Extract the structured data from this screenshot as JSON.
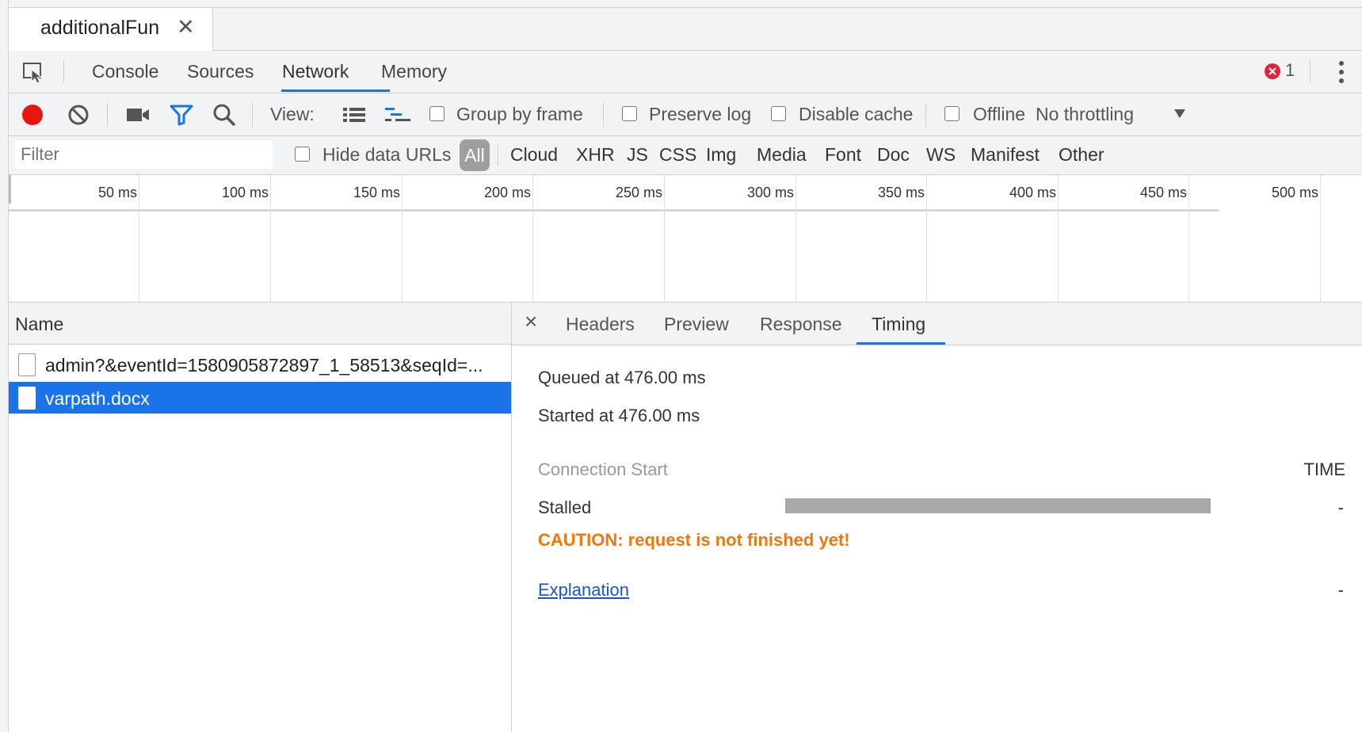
{
  "file_tab": {
    "label": "additionalFun",
    "close": "✕"
  },
  "main_tabs": [
    "Console",
    "Sources",
    "Network",
    "Memory"
  ],
  "errors": {
    "count": "1"
  },
  "toolbar": {
    "view_label": "View:",
    "group_by_frame": "Group by frame",
    "preserve_log": "Preserve log",
    "disable_cache": "Disable cache",
    "offline": "Offline",
    "throttling": "No throttling"
  },
  "filter": {
    "placeholder": "Filter",
    "hide_data_urls": "Hide data URLs",
    "types": [
      "All",
      "Cloud",
      "XHR",
      "JS",
      "CSS",
      "Img",
      "Media",
      "Font",
      "Doc",
      "WS",
      "Manifest",
      "Other"
    ]
  },
  "overview": {
    "ticks": [
      "50 ms",
      "100 ms",
      "150 ms",
      "200 ms",
      "250 ms",
      "300 ms",
      "350 ms",
      "400 ms",
      "450 ms",
      "500 ms"
    ]
  },
  "requests": {
    "header": "Name",
    "rows": [
      {
        "name": "admin?&eventId=1580905872897_1_58513&seqId=..."
      },
      {
        "name": "varpath.docx",
        "selected": true
      }
    ]
  },
  "detail": {
    "tabs": [
      "Headers",
      "Preview",
      "Response",
      "Timing"
    ],
    "active_tab": "Timing",
    "queued": "Queued at 476.00 ms",
    "started": "Started at 476.00 ms",
    "section": "Connection Start",
    "time_header": "TIME",
    "stalled_label": "Stalled",
    "stalled_value": "-",
    "caution": "CAUTION: request is not finished yet!",
    "explanation": "Explanation",
    "explanation_value": "-"
  },
  "colors": {
    "accent": "#1a73e8",
    "caution": "#f2760b",
    "record": "#e8160c",
    "error": "#e0243a"
  }
}
